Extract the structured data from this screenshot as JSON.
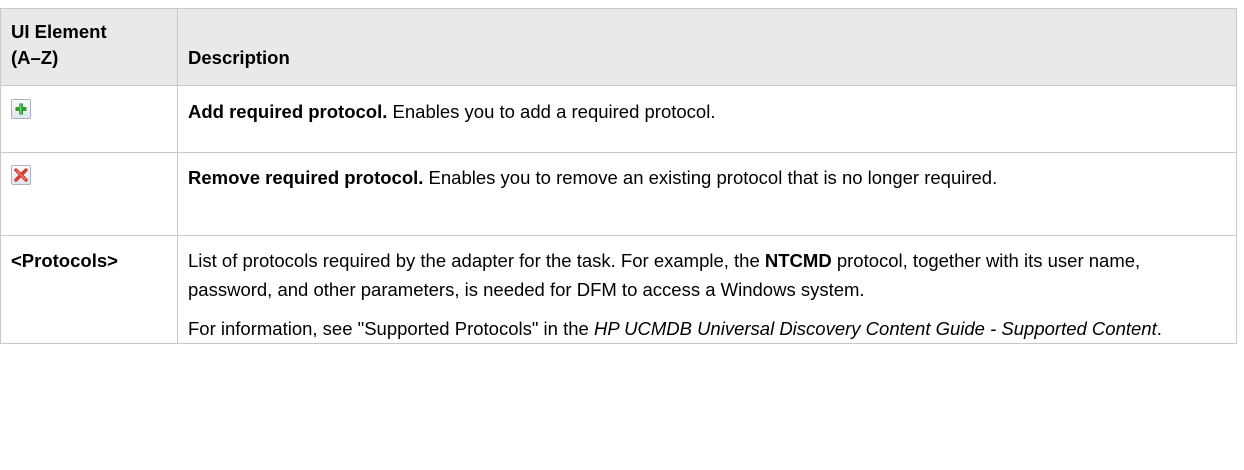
{
  "header": {
    "col1": "UI Element (A–Z)",
    "col1_line1": "UI Element",
    "col1_line2": "(A–Z)",
    "col2": "Description"
  },
  "rows": [
    {
      "icon": "add-plus-icon",
      "title": "Add required protocol.",
      "text": " Enables you to add a required protocol."
    },
    {
      "icon": "remove-x-icon",
      "title": "Remove required protocol.",
      "text": " Enables you to remove an existing protocol that is no longer required."
    },
    {
      "element": "<Protocols>",
      "para1_a": "List of protocols required by the adapter for the task. For example, the ",
      "para1_bold": "NTCMD",
      "para1_b": " protocol, together with its user name, password, and other parameters, is needed for DFM to access a Windows system.",
      "para2_a": "For information, see \"Supported Protocols\" in the ",
      "para2_italic": "HP UCMDB Universal Discovery Content Guide - Supported Content",
      "para2_b": "."
    }
  ],
  "colors": {
    "header_bg": "#e9e9e9",
    "border": "#c9c9c9",
    "plus_green": "#2f9e2f",
    "x_red": "#d63a2e"
  }
}
